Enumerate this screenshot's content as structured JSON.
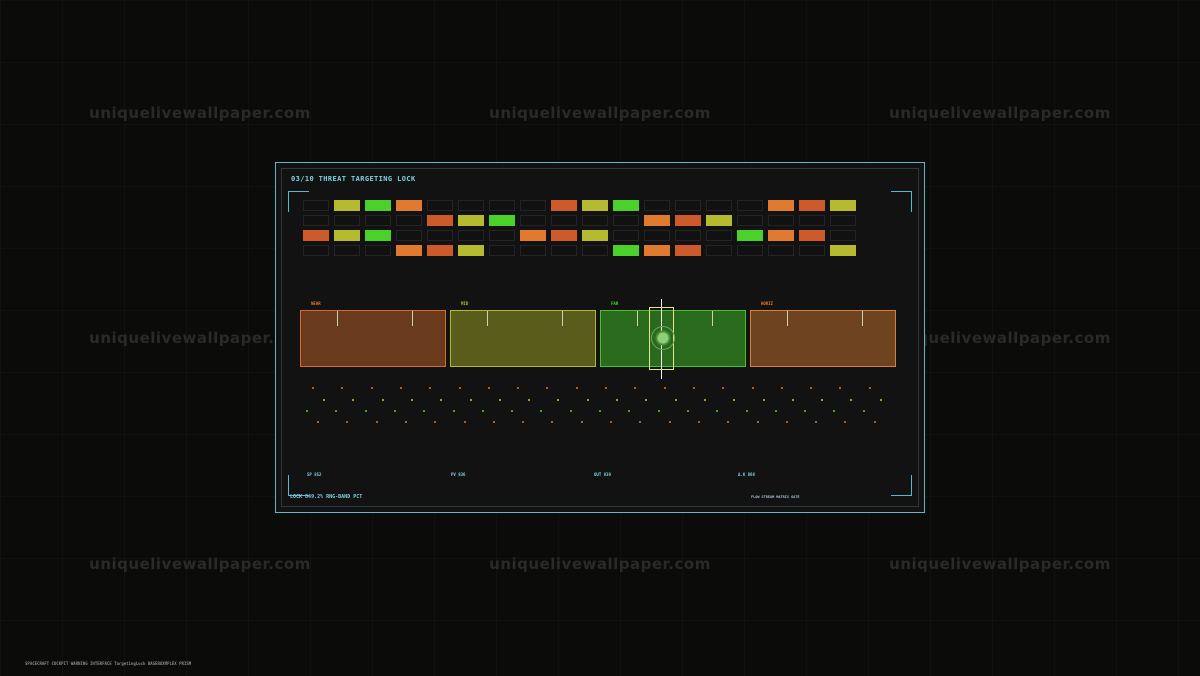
{
  "watermark": "uniquelivewallpaper.com",
  "panel": {
    "title": "03/10  THREAT TARGETING LOCK",
    "accent_color": "#5fb8c9"
  },
  "threat_grid": {
    "colors": {
      "O": "#e07a2e",
      "R": "#cc5a2a",
      "Y": "#b6ba2e",
      "G": "#4ad22a"
    },
    "rows": [
      [
        ".",
        "Y",
        "G",
        "O",
        ".",
        ".",
        ".",
        ".",
        "R",
        "Y",
        "G",
        ".",
        ".",
        ".",
        ".",
        "O",
        "R",
        "Y"
      ],
      [
        ".",
        ".",
        ".",
        ".",
        "R",
        "Y",
        "G",
        ".",
        ".",
        ".",
        ".",
        "O",
        "R",
        "Y",
        ".",
        ".",
        ".",
        "."
      ],
      [
        "R",
        "Y",
        "G",
        ".",
        ".",
        ".",
        ".",
        "O",
        "R",
        "Y",
        ".",
        ".",
        ".",
        ".",
        "G",
        "O",
        "R",
        "."
      ],
      [
        ".",
        ".",
        ".",
        "O",
        "R",
        "Y",
        ".",
        ".",
        ".",
        ".",
        "G",
        "O",
        "R",
        ".",
        ".",
        ".",
        ".",
        "Y"
      ]
    ]
  },
  "range_zones": [
    {
      "label": "NEAR",
      "label_color": "#e07a2e",
      "fill": "#6a3a1c",
      "border": "#d86a30"
    },
    {
      "label": "MID",
      "label_color": "#b6ba2e",
      "fill": "#5a5c1c",
      "border": "#b0b838"
    },
    {
      "label": "FAR",
      "label_color": "#4ad22a",
      "fill": "#2a6a1c",
      "border": "#4ac02a"
    },
    {
      "label": "HORIZ",
      "label_color": "#e07a2e",
      "fill": "#6e4420",
      "border": "#d8803a"
    }
  ],
  "dot_colors": {
    "orange": "#e07a2e",
    "yellow": "#c8cc3a",
    "green": "#5ad22a"
  },
  "stats": [
    {
      "label": "SP 852"
    },
    {
      "label": "PV 836"
    },
    {
      "label": "OUT 839"
    },
    {
      "label": "Δ.K 868"
    }
  ],
  "footer": {
    "left": "LOCK 849.2%  RNG-BAND PCT",
    "right": "FLOW STREAM   MATRIX GATE"
  },
  "caption": "SPACECRAFT COCKPIT WARNING INTERFACE   TargetingLock   BASEBOXMPLEX   PRISM"
}
